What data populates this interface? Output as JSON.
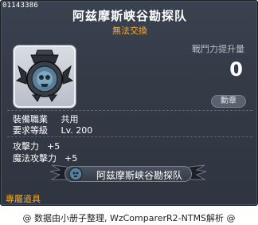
{
  "item": {
    "id": "01143386",
    "name": "阿兹摩斯峡谷勘探队",
    "trade_note": "無法交換"
  },
  "combat_power": {
    "label": "戰鬥力提升量",
    "value": "0"
  },
  "medal_badge": "勳章",
  "requirements": [
    {
      "label": "裝備職業",
      "value": "共用"
    },
    {
      "label": "要求等級",
      "value": "Lv. 200"
    }
  ],
  "bonuses": [
    {
      "label": "攻擊力",
      "value": "+5"
    },
    {
      "label": "魔法攻擊力",
      "value": "+5"
    }
  ],
  "set_name": "阿兹摩斯峡谷勘探队",
  "exclusive_label": "專屬道具",
  "footer": "@ 数据由小册子整理, WzComparerR2-NTMS解析 @",
  "colors": {
    "background": "#343b47",
    "accent_orange": "#ffaa22",
    "text": "#ffffff"
  },
  "icons": [
    "medal-emblem-icon",
    "set-emblem-icon",
    "wing-left-icon",
    "wing-right-icon"
  ]
}
